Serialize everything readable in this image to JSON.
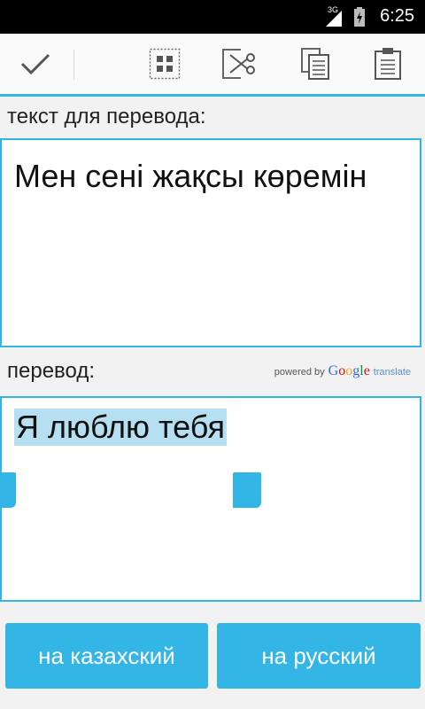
{
  "status_bar": {
    "network": "3G",
    "time": "6:25"
  },
  "toolbar": {
    "done_icon": "check-icon",
    "select_all_icon": "select-all-icon",
    "cut_icon": "cut-icon",
    "copy_icon": "copy-icon",
    "paste_icon": "paste-icon"
  },
  "source": {
    "label": "текст для перевода:",
    "text": "Мен сені жақсы көремін"
  },
  "target": {
    "label": "перевод:",
    "text": "Я люблю тебя",
    "powered_by": "powered by",
    "google": "Google",
    "translate": "translate"
  },
  "buttons": {
    "to_kazakh": "на казахский",
    "to_russian": "на русский"
  },
  "colors": {
    "accent": "#33b5e5",
    "selection": "#b6e0f1"
  }
}
